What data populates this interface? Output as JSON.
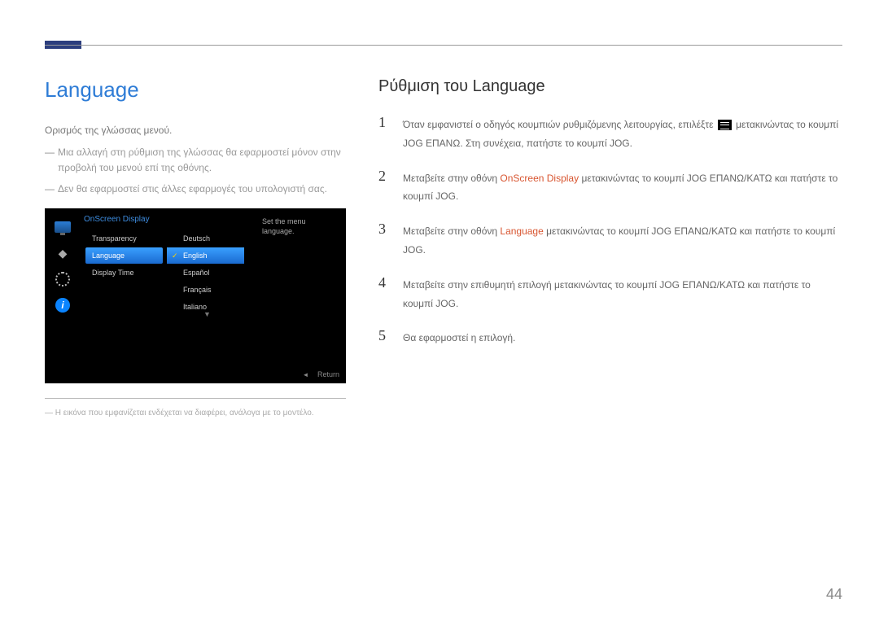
{
  "page_number": "44",
  "left": {
    "heading": "Language",
    "definition": "Ορισμός της γλώσσας μενού.",
    "bullets": [
      "Μια αλλαγή στη ρύθμιση της γλώσσας θα εφαρμοστεί μόνον στην προβολή του μενού επί της οθόνης.",
      "Δεν θα εφαρμοστεί στις άλλες εφαρμογές του υπολογιστή σας."
    ],
    "footnote": "― Η εικόνα που εμφανίζεται ενδέχεται να διαφέρει, ανάλογα με το μοντέλο.",
    "osd": {
      "title": "OnScreen Display",
      "menu_items": [
        "Transparency",
        "Language",
        "Display Time"
      ],
      "selected_menu": "Language",
      "languages": [
        "Deutsch",
        "English",
        "Español",
        "Français",
        "Italiano"
      ],
      "selected_language": "English",
      "help_line1": "Set the menu",
      "help_line2": "language.",
      "return_label": "Return"
    }
  },
  "right": {
    "heading": "Ρύθμιση του Language",
    "steps": [
      {
        "num": "1",
        "before": "Όταν εμφανιστεί ο οδηγός κουμπιών ρυθμιζόμενης λειτουργίας, επιλέξτε",
        "after": "μετακινώντας το κουμπί JOG ΕΠΑΝΩ. Στη συνέχεια, πατήστε το κουμπί JOG.",
        "has_icon": true
      },
      {
        "num": "2",
        "before": "Μεταβείτε στην οθόνη",
        "highlight": "OnScreen Display",
        "after": "μετακινώντας το κουμπί JOG ΕΠΑΝΩ/ΚΑΤΩ και πατήστε το κουμπί JOG."
      },
      {
        "num": "3",
        "before": "Μεταβείτε στην οθόνη",
        "highlight": "Language",
        "after": "μετακινώντας το κουμπί JOG ΕΠΑΝΩ/ΚΑΤΩ και πατήστε το κουμπί JOG."
      },
      {
        "num": "4",
        "plain": "Μεταβείτε στην επιθυμητή επιλογή μετακινώντας το κουμπί JOG ΕΠΑΝΩ/ΚΑΤΩ και πατήστε το κουμπί JOG."
      },
      {
        "num": "5",
        "plain": "Θα εφαρμοστεί η επιλογή."
      }
    ]
  }
}
